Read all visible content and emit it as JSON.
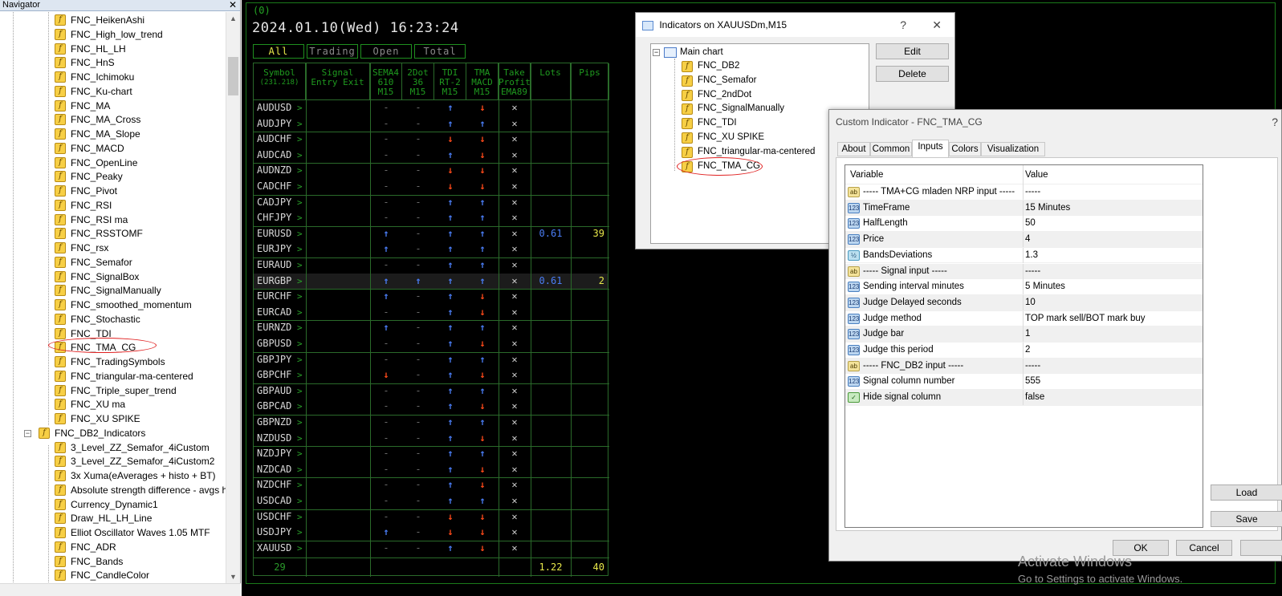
{
  "navigator": {
    "title": "Navigator",
    "items": [
      {
        "label": "FNC_HeikenAshi",
        "level": 2
      },
      {
        "label": "FNC_High_low_trend",
        "level": 2
      },
      {
        "label": "FNC_HL_LH",
        "level": 2
      },
      {
        "label": "FNC_HnS",
        "level": 2
      },
      {
        "label": "FNC_Ichimoku",
        "level": 2
      },
      {
        "label": "FNC_Ku-chart",
        "level": 2
      },
      {
        "label": "FNC_MA",
        "level": 2
      },
      {
        "label": "FNC_MA_Cross",
        "level": 2
      },
      {
        "label": "FNC_MA_Slope",
        "level": 2
      },
      {
        "label": "FNC_MACD",
        "level": 2
      },
      {
        "label": "FNC_OpenLine",
        "level": 2
      },
      {
        "label": "FNC_Peaky",
        "level": 2
      },
      {
        "label": "FNC_Pivot",
        "level": 2
      },
      {
        "label": "FNC_RSI",
        "level": 2
      },
      {
        "label": "FNC_RSI ma",
        "level": 2
      },
      {
        "label": "FNC_RSSTOMF",
        "level": 2
      },
      {
        "label": "FNC_rsx",
        "level": 2
      },
      {
        "label": "FNC_Semafor",
        "level": 2
      },
      {
        "label": "FNC_SignalBox",
        "level": 2
      },
      {
        "label": "FNC_SignalManually",
        "level": 2
      },
      {
        "label": "FNC_smoothed_momentum",
        "level": 2
      },
      {
        "label": "FNC_Stochastic",
        "level": 2
      },
      {
        "label": "FNC_TDI",
        "level": 2
      },
      {
        "label": "FNC_TMA_CG",
        "level": 2
      },
      {
        "label": "FNC_TradingSymbols",
        "level": 2
      },
      {
        "label": "FNC_triangular-ma-centered",
        "level": 2
      },
      {
        "label": "FNC_Triple_super_trend",
        "level": 2
      },
      {
        "label": "FNC_XU ma",
        "level": 2
      },
      {
        "label": "FNC_XU SPIKE",
        "level": 2
      },
      {
        "label": "FNC_DB2_Indicators",
        "level": 1
      },
      {
        "label": "3_Level_ZZ_Semafor_4iCustom",
        "level": 2
      },
      {
        "label": "3_Level_ZZ_Semafor_4iCustom2",
        "level": 2
      },
      {
        "label": "3x Xuma(eAverages + histo + BT)",
        "level": 2
      },
      {
        "label": "Absolute strength difference - avgs h",
        "level": 2
      },
      {
        "label": "Currency_Dynamic1",
        "level": 2
      },
      {
        "label": "Draw_HL_LH_Line",
        "level": 2
      },
      {
        "label": "Elliot Oscillator Waves 1.05 MTF",
        "level": 2
      },
      {
        "label": "FNC_ADR",
        "level": 2
      },
      {
        "label": "FNC_Bands",
        "level": 2
      },
      {
        "label": "FNC_CandleColor",
        "level": 2
      }
    ]
  },
  "chart": {
    "status": "(0)",
    "datetime": "2024.01.10(Wed) 16:23:24",
    "filters": [
      {
        "label": "All",
        "active": true
      },
      {
        "label": "Trading",
        "active": false
      },
      {
        "label": "Open",
        "active": false
      },
      {
        "label": "Total",
        "active": false
      }
    ],
    "headers": [
      {
        "l1": "Symbol",
        "l2": "(231.218)",
        "l3": ""
      },
      {
        "l1": "Signal",
        "l2": "Entry Exit",
        "l3": ""
      },
      {
        "l1": "SEMA4",
        "l2": "610",
        "l3": "M15"
      },
      {
        "l1": "2Dot",
        "l2": "36",
        "l3": "M15"
      },
      {
        "l1": "TDI",
        "l2": "RT-2",
        "l3": "M15"
      },
      {
        "l1": "TMA",
        "l2": "MACD",
        "l3": "M15"
      },
      {
        "l1": "Take",
        "l2": "Profit",
        "l3": "EMA89"
      },
      {
        "l1": "Lots",
        "l2": "",
        "l3": ""
      },
      {
        "l1": "Pips",
        "l2": "",
        "l3": ""
      }
    ],
    "rows": [
      {
        "sym": "AUDUSD",
        "sema": "-",
        "dot": "-",
        "tdi": "up",
        "tma": "dn",
        "lots": "",
        "pips": ""
      },
      {
        "sym": "AUDJPY",
        "sema": "-",
        "dot": "-",
        "tdi": "up",
        "tma": "up",
        "lots": "",
        "pips": ""
      },
      {
        "sym": "AUDCHF",
        "sema": "-",
        "dot": "-",
        "tdi": "dn",
        "tma": "dn",
        "lots": "",
        "pips": ""
      },
      {
        "sym": "AUDCAD",
        "sema": "-",
        "dot": "-",
        "tdi": "up",
        "tma": "dn",
        "lots": "",
        "pips": ""
      },
      {
        "sym": "AUDNZD",
        "sema": "-",
        "dot": "-",
        "tdi": "dn",
        "tma": "dn",
        "lots": "",
        "pips": ""
      },
      {
        "sym": "CADCHF",
        "sema": "-",
        "dot": "-",
        "tdi": "dn",
        "tma": "dn",
        "lots": "",
        "pips": ""
      },
      {
        "sym": "CADJPY",
        "sema": "-",
        "dot": "-",
        "tdi": "up",
        "tma": "up",
        "lots": "",
        "pips": ""
      },
      {
        "sym": "CHFJPY",
        "sema": "-",
        "dot": "-",
        "tdi": "up",
        "tma": "up",
        "lots": "",
        "pips": ""
      },
      {
        "sym": "EURUSD",
        "sema": "up",
        "dot": "-",
        "tdi": "up",
        "tma": "up",
        "lots": "0.61",
        "pips": "39"
      },
      {
        "sym": "EURJPY",
        "sema": "up",
        "dot": "-",
        "tdi": "up",
        "tma": "up",
        "lots": "",
        "pips": ""
      },
      {
        "sym": "EURAUD",
        "sema": "-",
        "dot": "-",
        "tdi": "up",
        "tma": "up",
        "lots": "",
        "pips": ""
      },
      {
        "sym": "EURGBP",
        "sema": "up",
        "dot": "up",
        "tdi": "up",
        "tma": "up",
        "lots": "0.61",
        "pips": "2",
        "highlight": true
      },
      {
        "sym": "EURCHF",
        "sema": "up",
        "dot": "-",
        "tdi": "up",
        "tma": "dn",
        "lots": "",
        "pips": ""
      },
      {
        "sym": "EURCAD",
        "sema": "-",
        "dot": "-",
        "tdi": "up",
        "tma": "dn",
        "lots": "",
        "pips": ""
      },
      {
        "sym": "EURNZD",
        "sema": "up",
        "dot": "-",
        "tdi": "up",
        "tma": "up",
        "lots": "",
        "pips": ""
      },
      {
        "sym": "GBPUSD",
        "sema": "-",
        "dot": "-",
        "tdi": "up",
        "tma": "dn",
        "lots": "",
        "pips": ""
      },
      {
        "sym": "GBPJPY",
        "sema": "-",
        "dot": "-",
        "tdi": "up",
        "tma": "up",
        "lots": "",
        "pips": ""
      },
      {
        "sym": "GBPCHF",
        "sema": "dn",
        "dot": "-",
        "tdi": "up",
        "tma": "dn",
        "lots": "",
        "pips": ""
      },
      {
        "sym": "GBPAUD",
        "sema": "-",
        "dot": "-",
        "tdi": "up",
        "tma": "up",
        "lots": "",
        "pips": ""
      },
      {
        "sym": "GBPCAD",
        "sema": "-",
        "dot": "-",
        "tdi": "up",
        "tma": "dn",
        "lots": "",
        "pips": ""
      },
      {
        "sym": "GBPNZD",
        "sema": "-",
        "dot": "-",
        "tdi": "up",
        "tma": "up",
        "lots": "",
        "pips": ""
      },
      {
        "sym": "NZDUSD",
        "sema": "-",
        "dot": "-",
        "tdi": "up",
        "tma": "dn",
        "lots": "",
        "pips": ""
      },
      {
        "sym": "NZDJPY",
        "sema": "-",
        "dot": "-",
        "tdi": "up",
        "tma": "up",
        "lots": "",
        "pips": ""
      },
      {
        "sym": "NZDCAD",
        "sema": "-",
        "dot": "-",
        "tdi": "up",
        "tma": "dn",
        "lots": "",
        "pips": ""
      },
      {
        "sym": "NZDCHF",
        "sema": "-",
        "dot": "-",
        "tdi": "up",
        "tma": "dn",
        "lots": "",
        "pips": ""
      },
      {
        "sym": "USDCAD",
        "sema": "-",
        "dot": "-",
        "tdi": "up",
        "tma": "up",
        "lots": "",
        "pips": ""
      },
      {
        "sym": "USDCHF",
        "sema": "-",
        "dot": "-",
        "tdi": "dn",
        "tma": "dn",
        "lots": "",
        "pips": ""
      },
      {
        "sym": "USDJPY",
        "sema": "up",
        "dot": "-",
        "tdi": "dn",
        "tma": "dn",
        "lots": "",
        "pips": ""
      },
      {
        "sym": "XAUUSD",
        "sema": "-",
        "dot": "-",
        "tdi": "up",
        "tma": "dn",
        "lots": "",
        "pips": ""
      }
    ],
    "footer": {
      "count": "29",
      "lots": "1.22",
      "pips": "40"
    },
    "colors": {
      "up": "#4a7df5",
      "down": "#ff4a1a",
      "grid": "#2a6a2a"
    }
  },
  "indicators_dialog": {
    "title": "Indicators on XAUUSDm,M15",
    "help": "?",
    "close": "✕",
    "root": "Main chart",
    "items": [
      "FNC_DB2",
      "FNC_Semafor",
      "FNC_2ndDot",
      "FNC_SignalManually",
      "FNC_TDI",
      "FNC_XU SPIKE",
      "FNC_triangular-ma-centered",
      "FNC_TMA_CG"
    ],
    "edit": "Edit",
    "delete": "Delete"
  },
  "custom_dialog": {
    "title": "Custom Indicator - FNC_TMA_CG",
    "help": "?",
    "tabs": [
      "About",
      "Common",
      "Inputs",
      "Colors",
      "Visualization"
    ],
    "active_tab": "Inputs",
    "col_variable": "Variable",
    "col_value": "Value",
    "params": [
      {
        "type": "ab",
        "name": "----- TMA+CG mladen NRP input -----",
        "value": "-----"
      },
      {
        "type": "123",
        "name": "TimeFrame",
        "value": "15 Minutes"
      },
      {
        "type": "123",
        "name": "HalfLength",
        "value": "50"
      },
      {
        "type": "123",
        "name": "Price",
        "value": "4"
      },
      {
        "type": "va",
        "name": "BandsDeviations",
        "value": "1.3"
      },
      {
        "type": "ab",
        "name": "----- Signal input -----",
        "value": "-----"
      },
      {
        "type": "123",
        "name": "Sending interval minutes",
        "value": "5 Minutes"
      },
      {
        "type": "123",
        "name": "Judge Delayed seconds",
        "value": "10"
      },
      {
        "type": "123",
        "name": "Judge method",
        "value": "TOP mark sell/BOT mark buy"
      },
      {
        "type": "123",
        "name": "Judge bar",
        "value": "1"
      },
      {
        "type": "123",
        "name": "Judge this period",
        "value": "2"
      },
      {
        "type": "ab",
        "name": "----- FNC_DB2 input -----",
        "value": "-----"
      },
      {
        "type": "123",
        "name": "Signal column number",
        "value": "555"
      },
      {
        "type": "bool",
        "name": "Hide signal column",
        "value": "false"
      }
    ],
    "load": "Load",
    "save": "Save",
    "ok": "OK",
    "cancel": "Cancel"
  },
  "watermark": {
    "line1": "Activate Windows",
    "line2": "Go to Settings to activate Windows."
  },
  "icons": {
    "indicator": "custom-indicator-icon",
    "up": "up-arrow-icon",
    "down": "down-arrow-icon",
    "cross": "close-x-icon"
  }
}
